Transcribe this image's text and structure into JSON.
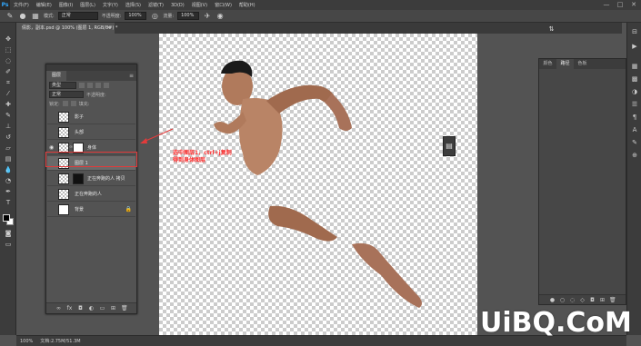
{
  "app": {
    "logo": "Ps"
  },
  "menu": [
    "文件(F)",
    "编辑(E)",
    "图像(I)",
    "图层(L)",
    "文字(Y)",
    "选择(S)",
    "滤镜(T)",
    "3D(D)",
    "视图(V)",
    "窗口(W)",
    "帮助(H)"
  ],
  "window_controls": [
    "—",
    "□",
    "✕"
  ],
  "options": {
    "mode_label": "模式:",
    "mode_value": "正常",
    "opacity_label": "不透明度:",
    "opacity_value": "100%",
    "flow_label": "流量:",
    "flow_value": "100%"
  },
  "document_tab": {
    "title": "倩影，副本.psd @ 100% (图层 1, RGB/8#) *",
    "close": "×"
  },
  "layers_panel": {
    "tab": "图层",
    "menu_icon": "≡",
    "filter_kind": "类型",
    "blend_mode": "正常",
    "opacity_label": "不透明度:",
    "fill_label": "填充:",
    "lock_label": "锁定:",
    "layers": [
      {
        "name": "影子"
      },
      {
        "name": "头部"
      },
      {
        "name": "身体"
      },
      {
        "name": "图层 1"
      },
      {
        "name": "正在奔跑的人 拷贝"
      },
      {
        "name": "正在奔跑的人"
      },
      {
        "name": "背景"
      }
    ]
  },
  "annotation": {
    "line1": "选中图层1，ctrl+j复制",
    "line2": "得到身体图层",
    "color": "#ff3030"
  },
  "right_panel": {
    "tabs": [
      "颜色",
      "路径",
      "色板"
    ]
  },
  "status": {
    "zoom": "100%",
    "doc": "文档:2.75M/51.3M"
  },
  "watermark": "UiBQ.CoM",
  "colors": {
    "accent": "#31a8ff",
    "highlight": "#e23b3b"
  }
}
